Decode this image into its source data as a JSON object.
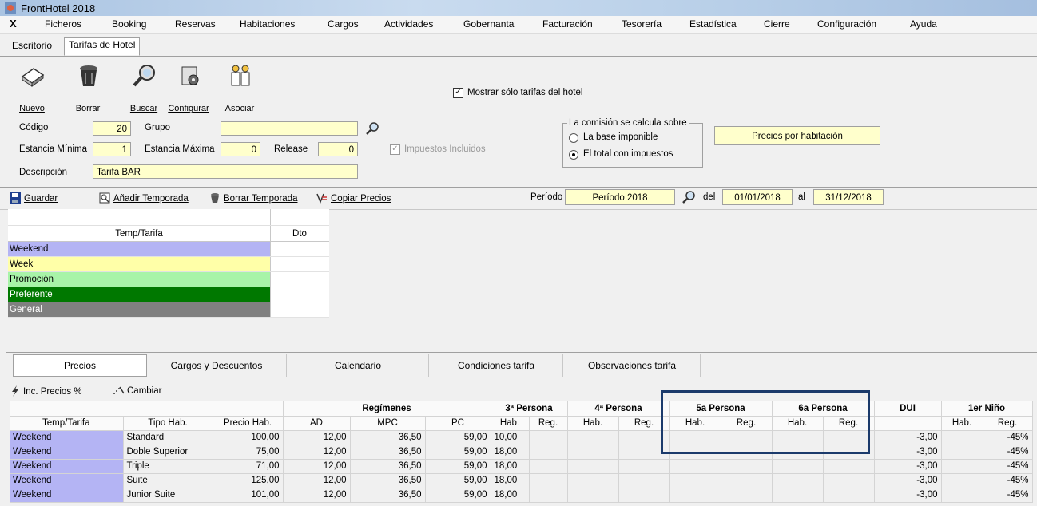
{
  "window": {
    "title": "FrontHotel 2018"
  },
  "menu": {
    "close": "X",
    "items": [
      "Ficheros",
      "Booking",
      "Reservas",
      "Habitaciones",
      "Cargos",
      "Actividades",
      "Gobernanta",
      "Facturación",
      "Tesorería",
      "Estadística",
      "Cierre",
      "Configuración",
      "Ayuda"
    ]
  },
  "doc_tabs": [
    "Escritorio",
    "Tarifas de Hotel"
  ],
  "toolbar": {
    "buttons": [
      "Nuevo",
      "Borrar",
      "Buscar",
      "Configurar",
      "Asociar"
    ],
    "only_hotel_label": "Mostrar sólo tarifas del hotel",
    "only_hotel_checked": true
  },
  "form": {
    "codigo_label": "Código",
    "codigo_value": "20",
    "grupo_label": "Grupo",
    "grupo_value": "",
    "estancia_min_label": "Estancia Mínima",
    "estancia_min_value": "1",
    "estancia_max_label": "Estancia Máxima",
    "estancia_max_value": "0",
    "release_label": "Release",
    "release_value": "0",
    "descripcion_label": "Descripción",
    "descripcion_value": "Tarifa BAR",
    "impuestos_label": "Impuestos Incluidos",
    "comision_group": "La comisión se calcula sobre",
    "comision_opt1": "La base imponible",
    "comision_opt2": "El total con impuestos",
    "comision_selected": "El total con impuestos",
    "precios_por": "Precios por habitación"
  },
  "actions": {
    "guardar": "Guardar",
    "anadir": "Añadir Temporada",
    "borrar": "Borrar Temporada",
    "copiar": "Copiar Precios",
    "periodo_label": "Período",
    "periodo_value": "Período 2018",
    "del_label": "del",
    "del_value": "01/01/2018",
    "al_label": "al",
    "al_value": "31/12/2018"
  },
  "seasons": {
    "header_name": "Temp/Tarifa",
    "header_dto": "Dto",
    "rows": [
      {
        "name": "Weekend",
        "color": "#b4b4f4",
        "text": "#000000"
      },
      {
        "name": "Week",
        "color": "#ffffa8",
        "text": "#000000"
      },
      {
        "name": "Promoción",
        "color": "#a8f4a8",
        "text": "#000000"
      },
      {
        "name": "Preferente",
        "color": "#007800",
        "text": "#ffffff"
      },
      {
        "name": "General",
        "color": "#808080",
        "text": "#ffffff"
      }
    ]
  },
  "bottom_tabs": [
    "Precios",
    "Cargos y Descuentos",
    "Calendario",
    "Condiciones tarifa",
    "Observaciones tarifa"
  ],
  "price_toolbar": {
    "inc": "Inc. Precios %",
    "cambiar": "Cambiar"
  },
  "price_table": {
    "group_headers": [
      "Regímenes",
      "3ª Persona",
      "4ª Persona",
      "5a Persona",
      "6a Persona",
      "DUI",
      "1er Niño"
    ],
    "col_headers": [
      "Temp/Tarifa",
      "Tipo Hab.",
      "Precio Hab.",
      "AD",
      "MPC",
      "PC",
      "Hab.",
      "Reg.",
      "Hab.",
      "Reg.",
      "Hab.",
      "Reg.",
      "Hab.",
      "Reg.",
      "",
      "Hab.",
      "Reg."
    ],
    "rows": [
      [
        "Weekend",
        "Standard",
        "100,00",
        "12,00",
        "36,50",
        "59,00",
        "10,00",
        "",
        "",
        "",
        "",
        "",
        "",
        "",
        "-3,00",
        "",
        "-45%"
      ],
      [
        "Weekend",
        "Doble Superior",
        "75,00",
        "12,00",
        "36,50",
        "59,00",
        "18,00",
        "",
        "",
        "",
        "",
        "",
        "",
        "",
        "-3,00",
        "",
        "-45%"
      ],
      [
        "Weekend",
        "Triple",
        "71,00",
        "12,00",
        "36,50",
        "59,00",
        "18,00",
        "",
        "",
        "",
        "",
        "",
        "",
        "",
        "-3,00",
        "",
        "-45%"
      ],
      [
        "Weekend",
        "Suite",
        "125,00",
        "12,00",
        "36,50",
        "59,00",
        "18,00",
        "",
        "",
        "",
        "",
        "",
        "",
        "",
        "-3,00",
        "",
        "-45%"
      ],
      [
        "Weekend",
        "Junior Suite",
        "101,00",
        "12,00",
        "36,50",
        "59,00",
        "18,00",
        "",
        "",
        "",
        "",
        "",
        "",
        "",
        "-3,00",
        "",
        "-45%"
      ]
    ]
  }
}
